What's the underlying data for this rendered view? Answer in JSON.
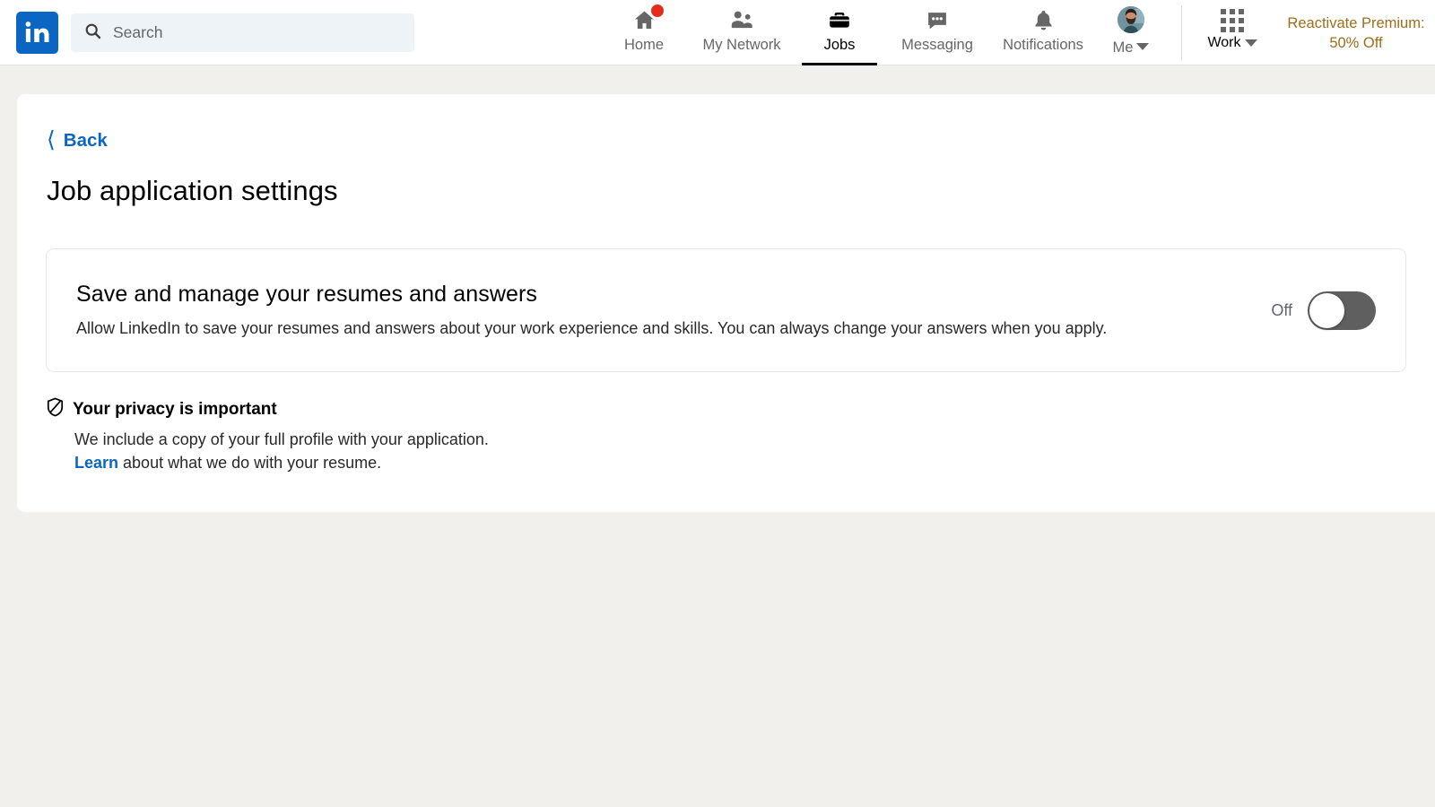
{
  "header": {
    "logo_alt": "LinkedIn",
    "search": {
      "placeholder": "Search",
      "value": ""
    },
    "nav": [
      {
        "id": "home",
        "label": "Home",
        "icon": "home-icon",
        "active": false,
        "badge": true
      },
      {
        "id": "my-network",
        "label": "My Network",
        "icon": "people-icon",
        "active": false,
        "badge": false
      },
      {
        "id": "jobs",
        "label": "Jobs",
        "icon": "briefcase-icon",
        "active": true,
        "badge": false
      },
      {
        "id": "messaging",
        "label": "Messaging",
        "icon": "message-bubble-icon",
        "active": false,
        "badge": false
      },
      {
        "id": "notifications",
        "label": "Notifications",
        "icon": "bell-icon",
        "active": false,
        "badge": false
      }
    ],
    "me": {
      "label": "Me",
      "icon": "avatar"
    },
    "work": {
      "label": "Work",
      "icon": "grid-dots-icon"
    },
    "premium_promo": "Reactivate Premium: 50% Off",
    "premium_color": "#9c6f19",
    "accent_color": "#0a66c2"
  },
  "page": {
    "back_label": "Back",
    "back_icon": "chevron-left-icon",
    "title": "Job application settings"
  },
  "setting_card": {
    "heading": "Save and manage your resumes and answers",
    "description": "Allow LinkedIn to save your resumes and answers about your work experience and skills. You can always change your answers when you apply.",
    "toggle": {
      "state_label": "Off",
      "checked": false
    }
  },
  "privacy": {
    "icon": "shield-privacy-icon",
    "title": "Your privacy is important",
    "line1": "We include a copy of your full profile with your application.",
    "link_text": "Learn",
    "line2_rest": " about what we do with your resume."
  }
}
